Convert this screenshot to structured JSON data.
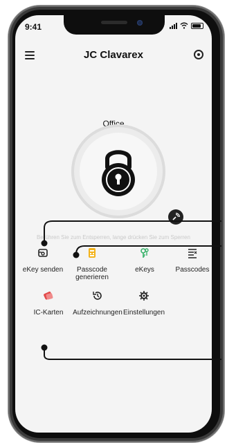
{
  "status": {
    "time": "9:41"
  },
  "header": {
    "title": "JC Clavarex"
  },
  "lock": {
    "name": "Office"
  },
  "hint": "Berühren Sie zum Entsperren, lange drücken Sie zum Sperren",
  "menu": [
    {
      "label": "eKey senden",
      "icon": "ekey-send-icon"
    },
    {
      "label": "Passcode generieren",
      "icon": "passcode-generate-icon"
    },
    {
      "label": "eKeys",
      "icon": "ekeys-icon"
    },
    {
      "label": "Passcodes",
      "icon": "passcodes-icon"
    },
    {
      "label": "IC-Karten",
      "icon": "ic-card-icon"
    },
    {
      "label": "Aufzeichnungen",
      "icon": "history-icon"
    },
    {
      "label": "Einstellungen",
      "icon": "gear-icon"
    }
  ],
  "colors": {
    "accent_yellow": "#f3b31b",
    "accent_green": "#38b26a",
    "accent_red": "#e24a4a",
    "text": "#222222"
  }
}
